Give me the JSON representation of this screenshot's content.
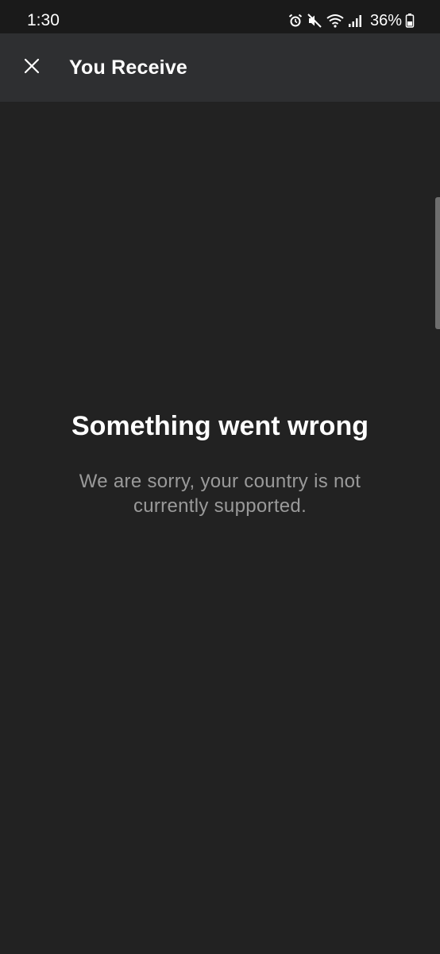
{
  "status_bar": {
    "time": "1:30",
    "battery": "36%",
    "icons": [
      "alarm-icon",
      "mute-icon",
      "wifi-icon",
      "signal-icon",
      "battery-icon"
    ]
  },
  "app_bar": {
    "title": "You Receive",
    "close_icon": "close-icon"
  },
  "error": {
    "title": "Something went wrong",
    "message": "We are sorry, your country is not currently supported."
  },
  "colors": {
    "background": "#222222",
    "app_bar": "#2e2f31",
    "status_bar": "#1a1a1a",
    "title_text": "#ffffff",
    "message_text": "#9a9a9a"
  }
}
